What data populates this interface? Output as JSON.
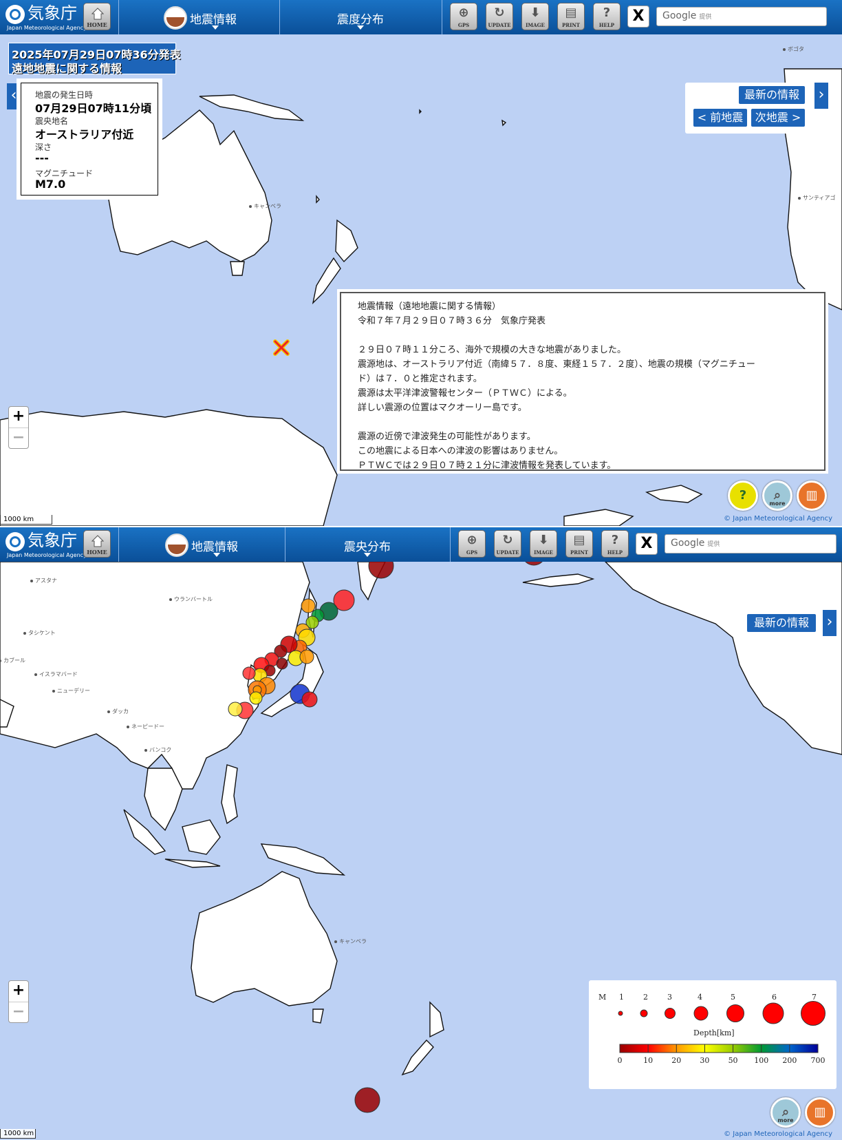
{
  "header": {
    "logo_jp": "気象庁",
    "logo_en": "Japan Meteorological Agency",
    "home_label": "HOME",
    "menu_quake": "地震情報",
    "menu_panel1": "震度分布",
    "menu_panel2": "震央分布",
    "tools": [
      "GPS",
      "UPDATE",
      "IMAGE",
      "PRINT",
      "HELP"
    ],
    "x_label": "X",
    "search_brand": "Google",
    "search_suffix": "提供"
  },
  "panel1": {
    "issued_line1": "2025年07月29日07時36分発表",
    "issued_line2": "遠地地震に関する情報",
    "card": {
      "time_label": "地震の発生日時",
      "time_value": "07月29日07時11分頃",
      "place_label": "震央地名",
      "place_value": "オーストラリア付近",
      "depth_label": "深さ",
      "depth_value": "---",
      "mag_label": "マグニチュード",
      "mag_value": "M7.0"
    },
    "nav": {
      "latest": "最新の情報",
      "prev": "< 前地震",
      "next": "次地震 >"
    },
    "notice_lines": [
      "地震情報（遠地地震に関する情報）",
      "令和７年７月２９日０７時３６分　気象庁発表",
      "",
      "２９日０７時１１分ころ、海外で規模の大きな地震がありました。",
      "震源地は、オーストラリア付近（南緯５７．８度、東経１５７．２度）、地震の規模（マグニチュー",
      "ド）は７．０と推定されます。",
      "震源は太平洋津波警報センター（ＰＴＷＣ）による。",
      "詳しい震源の位置はマクオーリー島です。",
      "",
      "震源の近傍で津波発生の可能性があります。",
      "この地震による日本への津波の影響はありません。",
      "ＰＴＷＣでは２９日０７時２１分に津波情報を発表しています。"
    ],
    "cities": [
      "ボゴタ",
      "サンティアゴ",
      "キャンベラ"
    ],
    "scale": "1000 km",
    "copyright": "© Japan Meteorological Agency",
    "buttons": {
      "help_icon": "tutorial-icon",
      "more": "more",
      "info_icon": "book-icon"
    }
  },
  "panel2": {
    "nav": {
      "latest": "最新の情報"
    },
    "cities": [
      "アスタナ",
      "ウランバートル",
      "タシケント",
      "カブール",
      "イスラマバード",
      "ニューデリー",
      "ダッカ",
      "ネーピードー",
      "バンコク",
      "キャンベラ"
    ],
    "legend": {
      "m_label": "M",
      "magnitudes": [
        "1",
        "2",
        "3",
        "4",
        "5",
        "6",
        "7"
      ],
      "depth_title": "Depth[km]",
      "depth_ticks": [
        "0",
        "10",
        "20",
        "30",
        "50",
        "100",
        "200",
        "700"
      ],
      "depth_colors": [
        "#990000",
        "#ff0000",
        "#ff9900",
        "#ffff00",
        "#99cc00",
        "#009933",
        "#0066cc",
        "#000099"
      ]
    },
    "scale": "1000 km",
    "copyright": "© Japan Meteorological Agency",
    "zoom_in": "+",
    "zoom_out": "−"
  }
}
